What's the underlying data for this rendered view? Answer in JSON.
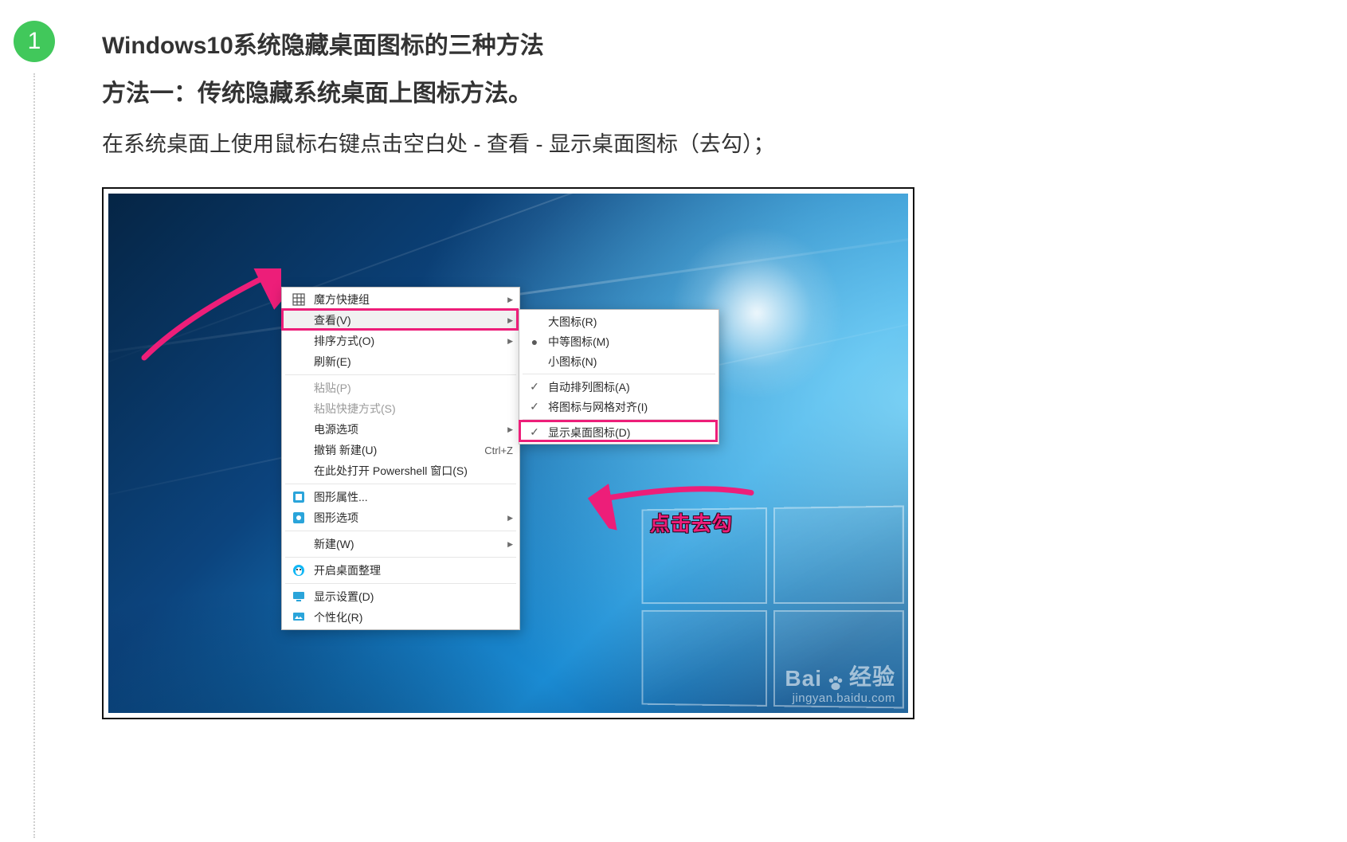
{
  "step_number": "1",
  "heading": "Windows10系统隐藏桌面图标的三种方法",
  "subheading": "方法一：传统隐藏系统桌面上图标方法。",
  "body_text": "在系统桌面上使用鼠标右键点击空白处 - 查看 - 显示桌面图标（去勾）；",
  "annotation_text": "点击去勾",
  "watermark": {
    "brand_left": "Bai",
    "brand_right": "经验",
    "url": "jingyan.baidu.com"
  },
  "context_menu": [
    {
      "label": "魔方快捷组",
      "icon": "grid-icon",
      "sub": true
    },
    {
      "label": "查看(V)",
      "sub": true,
      "highlight": true
    },
    {
      "label": "排序方式(O)",
      "sub": true
    },
    {
      "label": "刷新(E)"
    },
    {
      "sep": true
    },
    {
      "label": "粘贴(P)",
      "disabled": true
    },
    {
      "label": "粘贴快捷方式(S)",
      "disabled": true
    },
    {
      "label": "电源选项",
      "sub": true
    },
    {
      "label": "撤销 新建(U)",
      "hotkey": "Ctrl+Z"
    },
    {
      "label": "在此处打开 Powershell 窗口(S)"
    },
    {
      "sep": true
    },
    {
      "label": "图形属性...",
      "icon": "intel-gfx-icon"
    },
    {
      "label": "图形选项",
      "icon": "intel-opt-icon",
      "sub": true
    },
    {
      "sep": true
    },
    {
      "label": "新建(W)",
      "sub": true
    },
    {
      "sep": true
    },
    {
      "label": "开启桌面整理",
      "icon": "qq-icon"
    },
    {
      "sep": true
    },
    {
      "label": "显示设置(D)",
      "icon": "display-icon"
    },
    {
      "label": "个性化(R)",
      "icon": "personalize-icon"
    }
  ],
  "submenu": [
    {
      "mark": "",
      "label": "大图标(R)"
    },
    {
      "mark": "●",
      "label": "中等图标(M)"
    },
    {
      "mark": "",
      "label": "小图标(N)"
    },
    {
      "sep": true
    },
    {
      "mark": "✓",
      "label": "自动排列图标(A)"
    },
    {
      "mark": "✓",
      "label": "将图标与网格对齐(I)"
    },
    {
      "sep": true
    },
    {
      "mark": "✓",
      "label": "显示桌面图标(D)",
      "highlight": true
    }
  ]
}
